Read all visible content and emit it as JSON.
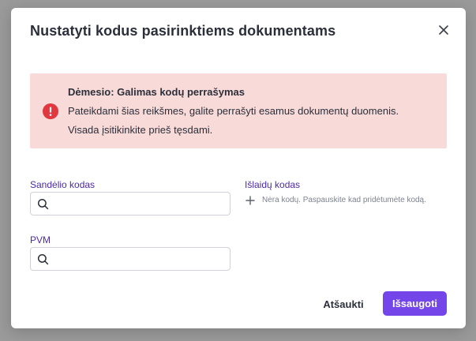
{
  "modal": {
    "title": "Nustatyti kodus pasirinktiems dokumentams",
    "close_icon": "close-icon"
  },
  "alert": {
    "icon": "exclamation-circle-icon",
    "title": "Dėmesio: Galimas kodų perrašymas",
    "line1": "Pateikdami šias reikšmes, galite perrašyti esamus dokumentų duomenis.",
    "line2": "Visada įsitikinkite prieš tęsdami.",
    "background": "#f8dad9",
    "icon_color": "#e0383e"
  },
  "fields": {
    "warehouse_code": {
      "label": "Sandėlio kodas",
      "value": "",
      "placeholder": ""
    },
    "expense_code": {
      "label": "Išlaidų kodas",
      "empty_text": "Nėra kodų. Paspauskite kad pridėtumėte kodą.",
      "icon": "plus-icon"
    },
    "vat": {
      "label": "PVM",
      "value": "",
      "placeholder": ""
    }
  },
  "footer": {
    "cancel_label": "Atšaukti",
    "save_label": "Išsaugoti"
  },
  "colors": {
    "accent": "#7445e8",
    "label": "#4b2aa8",
    "overlay": "#9a9a9a"
  }
}
